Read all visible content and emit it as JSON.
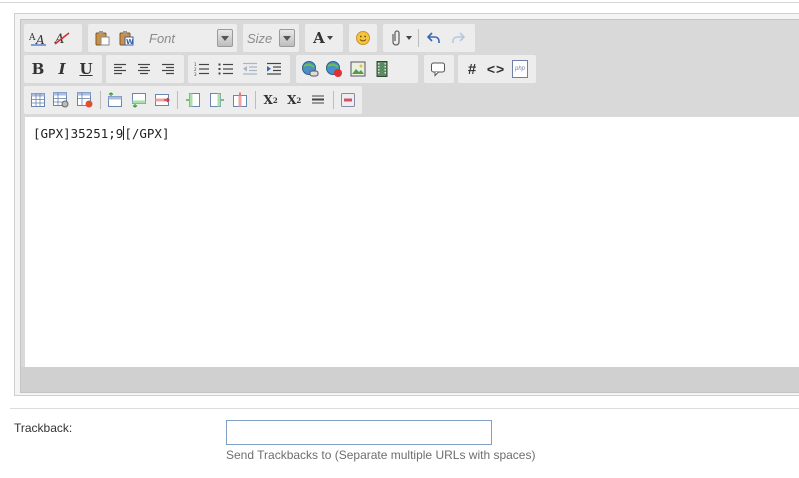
{
  "toolbar": {
    "font_placeholder": "Font",
    "size_placeholder": "Size",
    "text_color_glyph": "A",
    "bold_glyph": "B",
    "italic_glyph": "I",
    "underline_glyph": "U",
    "hash_glyph": "#",
    "code_glyph": "<>",
    "php_glyph": "php",
    "subscript_glyph": "X",
    "subscript_sub": "2",
    "superscript_glyph": "X",
    "superscript_sup": "2",
    "icons": {
      "row1": [
        "font-size-icon",
        "remove-format-icon",
        "paste-icon",
        "paste-word-icon",
        "font-select",
        "size-select",
        "text-color-icon",
        "smiley-icon",
        "attachment-icon",
        "undo-icon",
        "redo-icon"
      ],
      "row2": [
        "bold-icon",
        "italic-icon",
        "underline-icon",
        "align-left-icon",
        "align-center-icon",
        "align-right-icon",
        "ordered-list-icon",
        "unordered-list-icon",
        "outdent-icon",
        "indent-icon",
        "link-icon",
        "unlink-icon",
        "image-icon",
        "video-icon",
        "quote-icon",
        "hash-icon",
        "code-icon",
        "php-icon"
      ],
      "row3": [
        "table-icon",
        "table-properties-icon",
        "delete-table-icon",
        "insert-row-before-icon",
        "insert-row-after-icon",
        "delete-row-icon",
        "insert-col-before-icon",
        "insert-col-after-icon",
        "delete-col-icon",
        "subscript-icon",
        "superscript-icon",
        "horizontal-rule-icon",
        "remove-icon"
      ]
    }
  },
  "editor": {
    "content_before_caret": "[GPX]35251;9",
    "content_after_caret": "[/GPX]"
  },
  "trackback": {
    "label": "Trackback:",
    "value": "",
    "help_text": "Send Trackbacks to (Separate multiple URLs with spaces)"
  },
  "colors": {
    "toolbar_bg": "#d9d9d9",
    "group_bg": "#ededed",
    "input_border": "#7fa0c0"
  }
}
